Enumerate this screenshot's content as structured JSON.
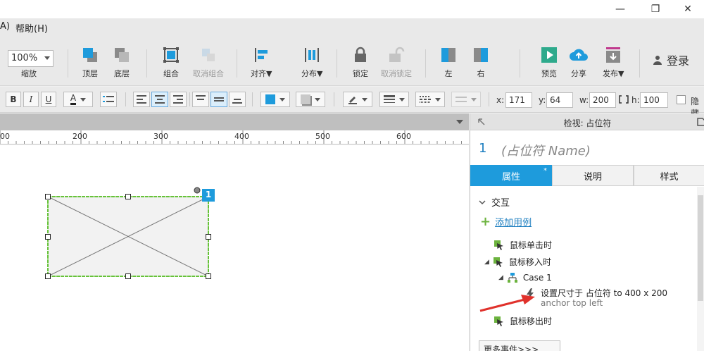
{
  "window": {
    "minimize": "—",
    "restore": "❐",
    "close": "✕"
  },
  "menu": {
    "partial": "A)",
    "help": "帮助(H)"
  },
  "toolbar": {
    "zoom": "100%",
    "zoom_label": "缩放",
    "bring_front": "顶层",
    "send_back": "底层",
    "group": "组合",
    "ungroup": "取消组合",
    "align": "对齐▼",
    "distribute": "分布▼",
    "lock": "锁定",
    "unlock": "取消锁定",
    "left": "左",
    "right": "右",
    "preview": "预览",
    "share": "分享",
    "publish": "发布▼",
    "login": "登录"
  },
  "format": {
    "bold": "B",
    "italic": "I",
    "underline": "U",
    "font_color": "A",
    "x_label": "x:",
    "x": "171",
    "y_label": "y:",
    "y": "64",
    "w_label": "w:",
    "w": "200",
    "h_label": "h:",
    "h": "100",
    "hide_label": "隐藏"
  },
  "ruler": {
    "marks": [
      "00",
      "200",
      "300",
      "400",
      "500",
      "600"
    ]
  },
  "widget": {
    "badge": "1"
  },
  "panel": {
    "title": "检视: 占位符",
    "index": "1",
    "name_placeholder": "(占位符 Name)",
    "tabs": [
      "属性",
      "说明",
      "样式"
    ],
    "tab_marker": "*",
    "section": "交互",
    "add_case": "添加用例",
    "events": {
      "click": "鼠标单击时",
      "mouse_enter": "鼠标移入时",
      "case": "Case 1",
      "action_line1": "设置尺寸于 占位符 to 400 x 200",
      "action_line2": "anchor top left",
      "mouse_leave": "鼠标移出时"
    },
    "more_events": "更多事件>>>"
  },
  "colors": {
    "accent": "#1e9bdc",
    "green": "#6cb33e",
    "selection": "#67c23a",
    "arrow": "#e0312b"
  }
}
